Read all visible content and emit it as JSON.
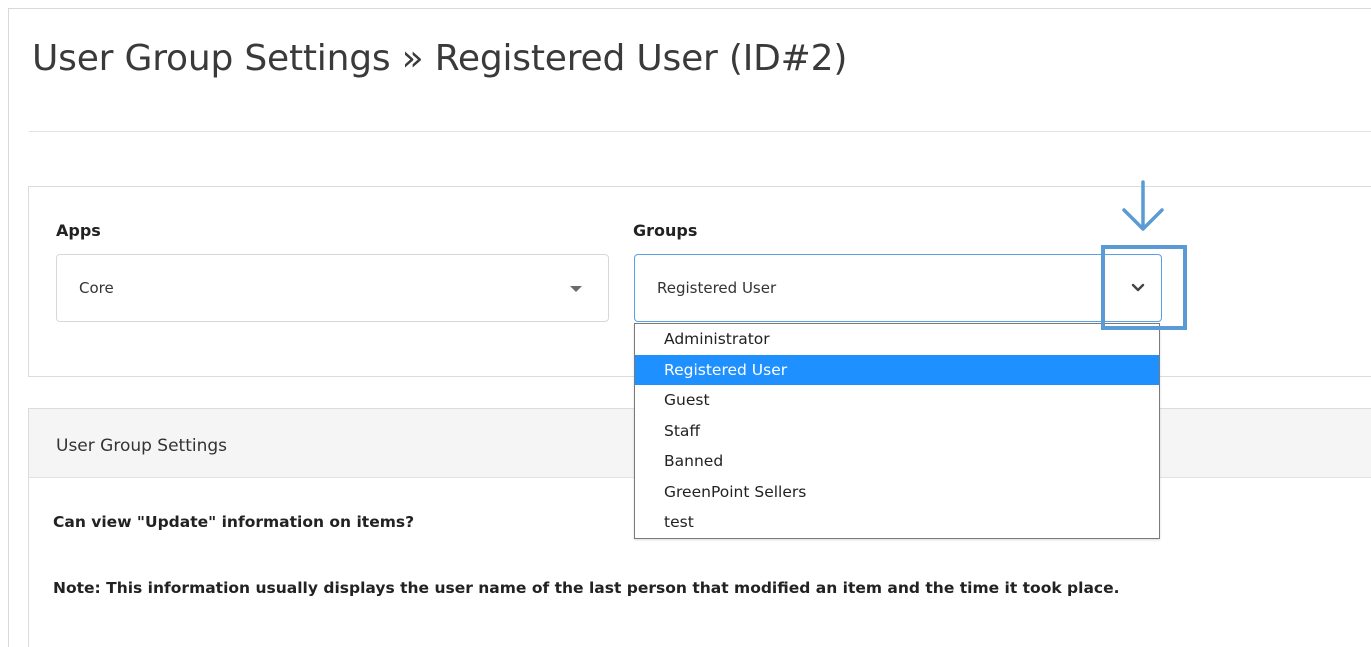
{
  "page": {
    "title": "User Group Settings » Registered User (ID#2)"
  },
  "filters": {
    "apps": {
      "label": "Apps",
      "selected": "Core"
    },
    "groups": {
      "label": "Groups",
      "selected": "Registered User",
      "options": [
        "Administrator",
        "Registered User",
        "Guest",
        "Staff",
        "Banned",
        "GreenPoint Sellers",
        "test"
      ],
      "highlighted_option": "Registered User"
    }
  },
  "annotation": {
    "arrow_icon": "arrow-down-icon",
    "color": "#5b9bd5"
  },
  "settings_panel": {
    "header": "User Group Settings",
    "question": "Can view \"Update\" information on items?",
    "note": "Note: This information usually displays the user name of the last person that modified an item and the time it took place."
  },
  "colors": {
    "accent": "#1e90ff",
    "annotation": "#5b9bd5",
    "focus_border": "#5aa0e6"
  }
}
